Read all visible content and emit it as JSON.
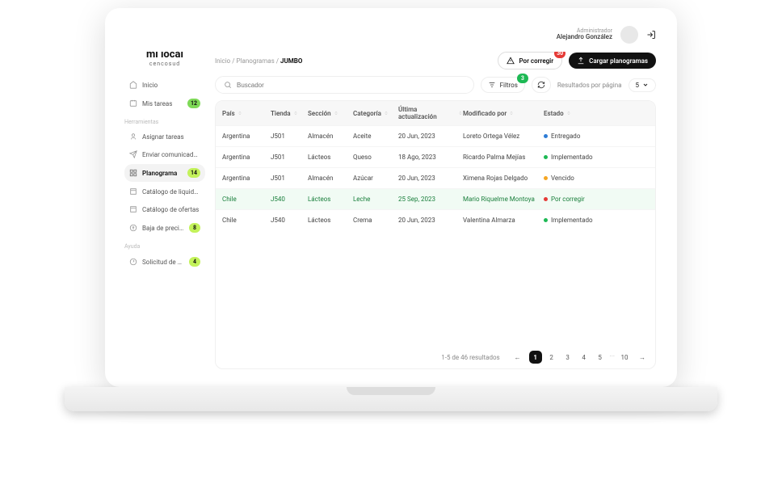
{
  "user": {
    "role": "Administrador",
    "name": "Alejandro González"
  },
  "logo": {
    "text": "mi local",
    "sub": "cencosud"
  },
  "sidebar": {
    "items": [
      {
        "icon": "home",
        "label": "Inicio",
        "badge": null
      },
      {
        "icon": "tasks",
        "label": "Mis tareas",
        "badge": "12",
        "badge_color": "green"
      }
    ],
    "section_tools": "Herramientas",
    "tools": [
      {
        "icon": "assign",
        "label": "Asignar tareas",
        "badge": null
      },
      {
        "icon": "send",
        "label": "Enviar comunicados",
        "badge": null
      },
      {
        "icon": "planogram",
        "label": "Planograma",
        "badge": "14",
        "badge_color": "lime",
        "active": true
      },
      {
        "icon": "catalog",
        "label": "Catálogo de liquidación",
        "badge": null
      },
      {
        "icon": "catalog",
        "label": "Catálogo de ofertas",
        "badge": null
      },
      {
        "icon": "price",
        "label": "Baja de precios",
        "badge": "8",
        "badge_color": "lime"
      }
    ],
    "section_help": "Ayuda",
    "help": [
      {
        "icon": "help",
        "label": "Solicitud de ayuda",
        "badge": "4",
        "badge_color": "lime"
      }
    ]
  },
  "breadcrumb": {
    "a": "Inicio",
    "b": "Planogramas",
    "c": "JUMBO"
  },
  "actions": {
    "por_corregir": "Por corregir",
    "por_corregir_count": "30",
    "cargar": "Cargar planogramas"
  },
  "toolbar": {
    "search_placeholder": "Buscador",
    "filtros": "Filtros",
    "filtros_count": "3",
    "rpp_label": "Resultados por página",
    "rpp_value": "5"
  },
  "table": {
    "headers": {
      "pais": "País",
      "tienda": "Tienda",
      "seccion": "Sección",
      "categoria": "Categoría",
      "ultima": "Última actualización",
      "modificado": "Modificado por",
      "estado": "Estado"
    },
    "rows": [
      {
        "pais": "Argentina",
        "tienda": "J501",
        "seccion": "Almacén",
        "categoria": "Aceite",
        "ultima": "20 Jun, 2023",
        "modificado": "Loreto Ortega Vélez",
        "estado": "Entregado",
        "dot": "blue"
      },
      {
        "pais": "Argentina",
        "tienda": "J501",
        "seccion": "Lácteos",
        "categoria": "Queso",
        "ultima": "18 Ago, 2023",
        "modificado": "Ricardo Palma Mejías",
        "estado": "Implementado",
        "dot": "green"
      },
      {
        "pais": "Argentina",
        "tienda": "J501",
        "seccion": "Almacén",
        "categoria": "Azúcar",
        "ultima": "20 Jun, 2023",
        "modificado": "Ximena Rojas Delgado",
        "estado": "Vencido",
        "dot": "orange"
      },
      {
        "pais": "Chile",
        "tienda": "J540",
        "seccion": "Lácteos",
        "categoria": "Leche",
        "ultima": "25 Sep, 2023",
        "modificado": "Mario Riquelme Montoya",
        "estado": "Por corregir",
        "dot": "red",
        "highlight": true
      },
      {
        "pais": "Chile",
        "tienda": "J540",
        "seccion": "Lácteos",
        "categoria": "Crema",
        "ultima": "20 Jun, 2023",
        "modificado": "Valentina Almarza",
        "estado": "Implementado",
        "dot": "green"
      }
    ]
  },
  "pagination": {
    "info": "1-5 de 46 resultados",
    "pages": [
      "1",
      "2",
      "3",
      "4",
      "5",
      "...",
      "10"
    ],
    "current": "1"
  }
}
